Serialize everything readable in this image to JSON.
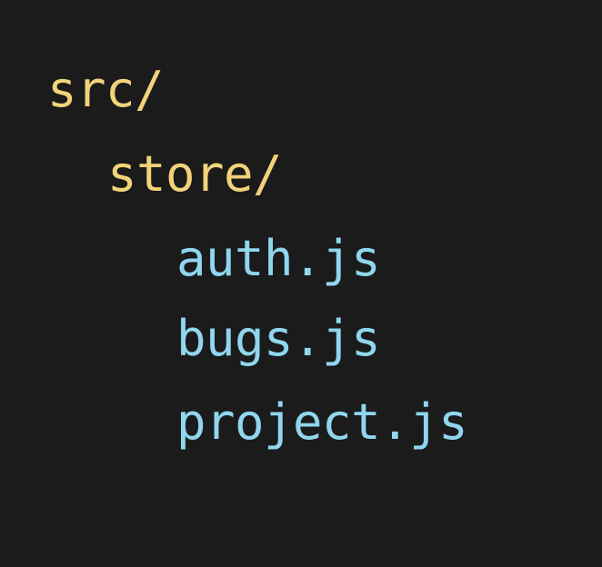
{
  "tree": {
    "root": "src/",
    "folder": "store/",
    "files": [
      "auth.js",
      "bugs.js",
      "project.js"
    ]
  },
  "colors": {
    "background": "#1b1b1b",
    "folder": "#f2d37a",
    "file": "#8fd6ee"
  }
}
